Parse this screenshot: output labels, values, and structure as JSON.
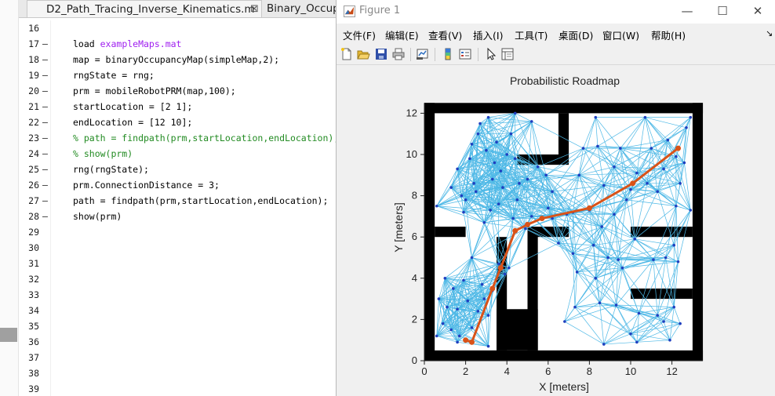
{
  "editor": {
    "tabs": [
      {
        "label": "D2_Path_Tracing_Inverse_Kinematics.m",
        "close": "⊠"
      },
      {
        "label": "Binary_Occupa"
      }
    ],
    "lines": [
      {
        "num": "16",
        "dash": "",
        "parts": []
      },
      {
        "num": "17",
        "dash": "—",
        "parts": [
          {
            "t": "load "
          },
          {
            "t": "exampleMaps.mat",
            "cls": "str"
          }
        ]
      },
      {
        "num": "18",
        "dash": "—",
        "parts": [
          {
            "t": "map = binaryOccupancyMap(simpleMap,2);"
          }
        ]
      },
      {
        "num": "19",
        "dash": "—",
        "parts": [
          {
            "t": "rngState = rng;"
          }
        ]
      },
      {
        "num": "20",
        "dash": "—",
        "parts": [
          {
            "t": "prm = mobileRobotPRM(map,100);"
          }
        ]
      },
      {
        "num": "21",
        "dash": "—",
        "parts": [
          {
            "t": "startLocation = [2 1];"
          }
        ]
      },
      {
        "num": "22",
        "dash": "—",
        "parts": [
          {
            "t": "endLocation = [12 10];"
          }
        ]
      },
      {
        "num": "23",
        "dash": "—",
        "comment": true,
        "parts": [
          {
            "t": "% path = findpath(prm,startLocation,endLocation);"
          }
        ]
      },
      {
        "num": "24",
        "dash": "—",
        "comment": true,
        "parts": [
          {
            "t": "% show(prm)"
          }
        ]
      },
      {
        "num": "25",
        "dash": "—",
        "parts": [
          {
            "t": "rng(rngState);"
          }
        ]
      },
      {
        "num": "26",
        "dash": "—",
        "parts": [
          {
            "t": "prm.ConnectionDistance = 3;"
          }
        ]
      },
      {
        "num": "27",
        "dash": "—",
        "parts": [
          {
            "t": "path = findpath(prm,startLocation,endLocation);"
          }
        ]
      },
      {
        "num": "28",
        "dash": "—",
        "parts": [
          {
            "t": "show(prm)"
          }
        ]
      },
      {
        "num": "29",
        "dash": "",
        "parts": []
      },
      {
        "num": "30",
        "dash": "",
        "parts": []
      },
      {
        "num": "31",
        "dash": "",
        "parts": []
      },
      {
        "num": "32",
        "dash": "",
        "parts": []
      },
      {
        "num": "33",
        "dash": "",
        "parts": []
      },
      {
        "num": "34",
        "dash": "",
        "parts": []
      },
      {
        "num": "35",
        "dash": "",
        "parts": []
      },
      {
        "num": "36",
        "dash": "",
        "parts": []
      },
      {
        "num": "37",
        "dash": "",
        "parts": []
      },
      {
        "num": "38",
        "dash": "",
        "parts": []
      },
      {
        "num": "39",
        "dash": "",
        "parts": []
      }
    ]
  },
  "figure": {
    "title": "Figure 1",
    "window_buttons": {
      "minimize": "—",
      "maximize": "☐",
      "close": "✕"
    },
    "menus": [
      "文件(F)",
      "编辑(E)",
      "查看(V)",
      "插入(I)",
      "工具(T)",
      "桌面(D)",
      "窗口(W)",
      "帮助(H)"
    ],
    "menu_arrow": "↘",
    "toolbar_icons": [
      "new-file-icon",
      "open-folder-icon",
      "save-icon",
      "print-icon",
      "link-plot-icon",
      "colorbar-icon",
      "legend-icon",
      "pointer-icon",
      "property-inspector-icon"
    ]
  },
  "colors": {
    "edges": "#4db8e6",
    "nodes": "#1f3fbf",
    "path": "#d95319",
    "obstacle": "#000000",
    "comment": "#228b22",
    "string": "#a020f0"
  },
  "chart_data": {
    "type": "scatter",
    "title": "Probabilistic Roadmap",
    "xlabel": "X [meters]",
    "ylabel": "Y [meters]",
    "xlim": [
      0,
      13.5
    ],
    "ylim": [
      0,
      12.5
    ],
    "xticks": [
      0,
      2,
      4,
      6,
      8,
      10,
      12
    ],
    "yticks": [
      0,
      2,
      4,
      6,
      8,
      10,
      12
    ],
    "grid": false,
    "map": {
      "width": 13.5,
      "height": 12.5,
      "obstacles": [
        [
          0,
          0,
          0.5,
          12.5
        ],
        [
          13,
          0,
          0.5,
          12.5
        ],
        [
          0,
          0,
          13.5,
          0.5
        ],
        [
          0,
          12,
          13.5,
          0.5
        ],
        [
          0.5,
          6.0,
          1.5,
          0.5
        ],
        [
          3.5,
          0.5,
          0.5,
          5.5
        ],
        [
          3.5,
          0.5,
          2.0,
          2.0
        ],
        [
          5.0,
          0.5,
          0.5,
          6.0
        ],
        [
          5.0,
          6.0,
          2.0,
          0.5
        ],
        [
          6.5,
          10.0,
          0.5,
          2.0
        ],
        [
          4.5,
          9.5,
          2.5,
          0.5
        ],
        [
          10.0,
          6.0,
          3.0,
          0.5
        ],
        [
          10.0,
          3.0,
          3.0,
          0.5
        ]
      ]
    },
    "series": [
      {
        "name": "nodes",
        "points": [
          [
            0.6,
            7.5
          ],
          [
            1.3,
            8.4
          ],
          [
            1.6,
            9.3
          ],
          [
            1.8,
            8.0
          ],
          [
            2.0,
            7.8
          ],
          [
            2.4,
            8.6
          ],
          [
            2.5,
            8.2
          ],
          [
            2.6,
            11.0
          ],
          [
            2.7,
            11.5
          ],
          [
            2.3,
            10.5
          ],
          [
            2.2,
            9.8
          ],
          [
            3.0,
            10.2
          ],
          [
            3.1,
            11.8
          ],
          [
            3.3,
            8.8
          ],
          [
            3.4,
            9.6
          ],
          [
            3.5,
            10.6
          ],
          [
            3.7,
            9.2
          ],
          [
            3.8,
            8.4
          ],
          [
            3.6,
            7.6
          ],
          [
            4.0,
            10.0
          ],
          [
            4.2,
            11.0
          ],
          [
            4.4,
            9.8
          ],
          [
            4.5,
            7.8
          ],
          [
            4.6,
            8.6
          ],
          [
            4.4,
            12.0
          ],
          [
            5.2,
            11.6
          ],
          [
            5.0,
            8.8
          ],
          [
            5.5,
            9.4
          ],
          [
            5.9,
            9.0
          ],
          [
            6.2,
            8.2
          ],
          [
            7.2,
            7.2
          ],
          [
            7.7,
            10.3
          ],
          [
            8.4,
            10.4
          ],
          [
            8.3,
            11.8
          ],
          [
            7.5,
            9.0
          ],
          [
            8.7,
            8.5
          ],
          [
            9.2,
            9.4
          ],
          [
            9.5,
            10.3
          ],
          [
            9.8,
            7.8
          ],
          [
            10.8,
            8.6
          ],
          [
            10.7,
            11.8
          ],
          [
            11.0,
            10.3
          ],
          [
            11.8,
            10.7
          ],
          [
            12.2,
            9.9
          ],
          [
            12.7,
            11.3
          ],
          [
            12.9,
            11.8
          ],
          [
            12.6,
            9.6
          ],
          [
            12.9,
            7.3
          ],
          [
            12.4,
            8.6
          ],
          [
            11.3,
            8.2
          ],
          [
            12.2,
            7.5
          ],
          [
            11.6,
            9.3
          ],
          [
            10.3,
            9.1
          ],
          [
            9.2,
            7.1
          ],
          [
            8.6,
            6.5
          ],
          [
            6.2,
            6.9
          ],
          [
            6.9,
            7.1
          ],
          [
            6.5,
            5.7
          ],
          [
            7.2,
            5.2
          ],
          [
            8.2,
            5.6
          ],
          [
            8.9,
            5.0
          ],
          [
            9.4,
            4.9
          ],
          [
            10.2,
            5.9
          ],
          [
            11.7,
            5.0
          ],
          [
            12.1,
            5.6
          ],
          [
            12.3,
            4.8
          ],
          [
            7.4,
            4.3
          ],
          [
            9.6,
            4.5
          ],
          [
            11.1,
            4.9
          ],
          [
            8.3,
            4.0
          ],
          [
            6.8,
            1.9
          ],
          [
            7.3,
            2.6
          ],
          [
            8.5,
            2.8
          ],
          [
            9.3,
            2.7
          ],
          [
            10.4,
            2.3
          ],
          [
            11.3,
            2.2
          ],
          [
            11.6,
            1.9
          ],
          [
            12.1,
            2.6
          ],
          [
            12.4,
            1.8
          ],
          [
            10.0,
            1.3
          ],
          [
            8.7,
            0.8
          ],
          [
            10.3,
            0.9
          ],
          [
            11.9,
            1.0
          ],
          [
            1.0,
            4.0
          ],
          [
            1.4,
            3.5
          ],
          [
            0.7,
            3.0
          ],
          [
            1.1,
            2.6
          ],
          [
            1.6,
            2.5
          ],
          [
            0.9,
            1.8
          ],
          [
            1.3,
            1.5
          ],
          [
            1.9,
            3.9
          ],
          [
            2.1,
            2.9
          ],
          [
            2.6,
            2.4
          ],
          [
            2.3,
            1.6
          ],
          [
            2.9,
            3.0
          ],
          [
            3.1,
            2.2
          ],
          [
            3.6,
            4.7
          ],
          [
            3.9,
            4.2
          ],
          [
            4.1,
            4.5
          ],
          [
            3.1,
            0.7
          ],
          [
            0.6,
            1.2
          ],
          [
            1.6,
            0.9
          ],
          [
            2.8,
            3.7
          ],
          [
            3.3,
            3.4
          ],
          [
            2.3,
            5.0
          ],
          [
            4.3,
            6.9
          ],
          [
            1.9,
            7.2
          ],
          [
            5.2,
            7.0
          ],
          [
            4.9,
            6.4
          ],
          [
            2.9,
            6.7
          ],
          [
            8.0,
            7.3
          ],
          [
            10.0,
            8.3
          ],
          [
            3.2,
            7.3
          ],
          [
            6.0,
            7.4
          ],
          [
            1.7,
            1.2
          ]
        ]
      },
      {
        "name": "path",
        "points": [
          [
            2.0,
            1.0
          ],
          [
            2.3,
            0.9
          ],
          [
            3.3,
            3.5
          ],
          [
            3.7,
            4.5
          ],
          [
            4.4,
            6.3
          ],
          [
            5.0,
            6.6
          ],
          [
            5.7,
            6.9
          ],
          [
            8.0,
            7.4
          ],
          [
            10.1,
            8.6
          ],
          [
            12.3,
            10.3
          ]
        ]
      }
    ]
  }
}
